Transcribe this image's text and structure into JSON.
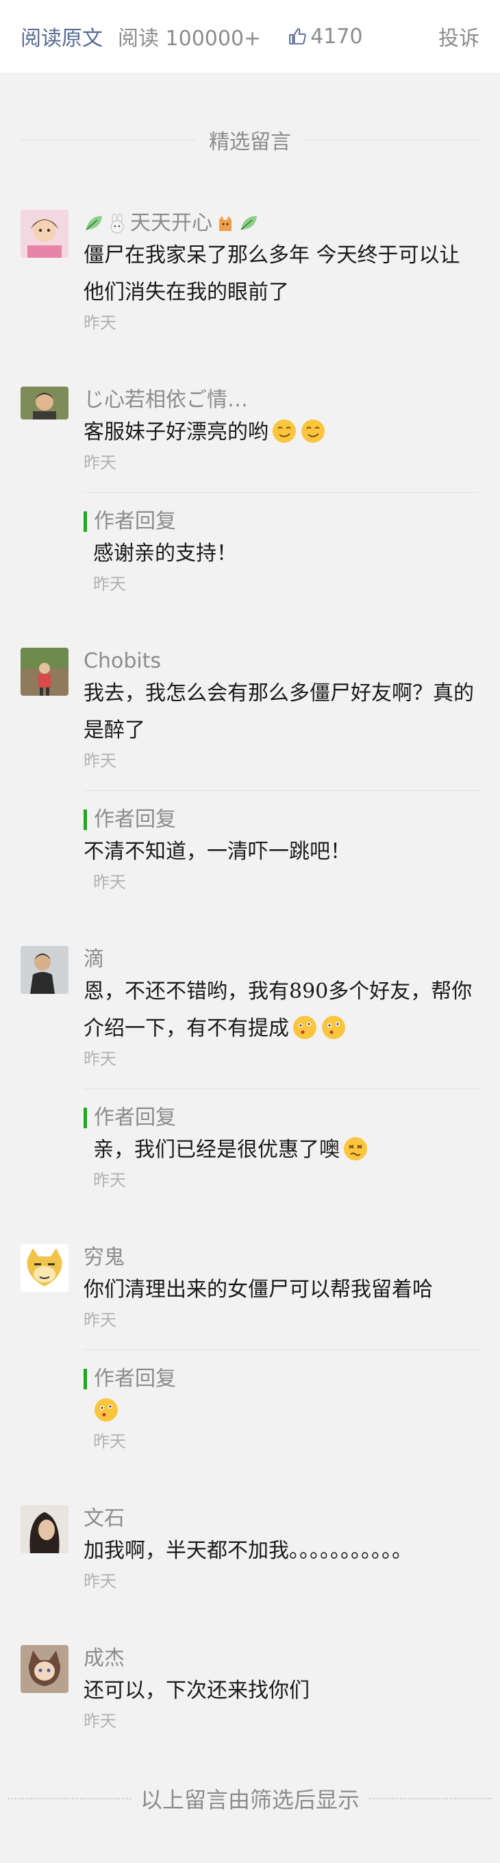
{
  "topbar": {
    "read_original": "阅读原文",
    "reads": "阅读 100000+",
    "likes": "4170",
    "complain": "投诉"
  },
  "section_title": "精选留言",
  "comments": [
    {
      "nick": "天天开心",
      "text": "僵尸在我家呆了那么多年 今天终于可以让他们消失在我的眼前了",
      "time": "昨天"
    },
    {
      "nick": "じ心若相依ご情…",
      "text": "客服妹子好漂亮的哟",
      "time": "昨天",
      "reply": {
        "label": "作者回复",
        "text": "感谢亲的支持！",
        "time": "昨天"
      }
    },
    {
      "nick": "Chobits",
      "text": "我去，我怎么会有那么多僵尸好友啊？真的是醉了",
      "time": "昨天",
      "reply": {
        "label": "作者回复",
        "text": "不清不知道，一清吓一跳吧！",
        "time": "昨天"
      }
    },
    {
      "nick": "滴",
      "text": "恩，不还不错哟，我有890多个好友，帮你介绍一下，有不有提成",
      "time": "昨天",
      "reply": {
        "label": "作者回复",
        "text": "亲，我们已经是很优惠了噢",
        "time": "昨天"
      }
    },
    {
      "nick": "穷鬼",
      "text": "你们清理出来的女僵尸可以帮我留着哈",
      "time": "昨天",
      "reply": {
        "label": "作者回复",
        "text": "",
        "time": "昨天"
      }
    },
    {
      "nick": "文石",
      "text": "加我啊，半天都不加我。。。。。。。。。。。",
      "time": "昨天"
    },
    {
      "nick": "成杰",
      "text": "还可以，下次还来找你们",
      "time": "昨天"
    }
  ],
  "footer_note": "以上留言由筛选后显示",
  "colors": {
    "link": "#576b95",
    "accent_green": "#1aad19",
    "muted": "#8c8c8c",
    "background": "#f2f2f2"
  }
}
